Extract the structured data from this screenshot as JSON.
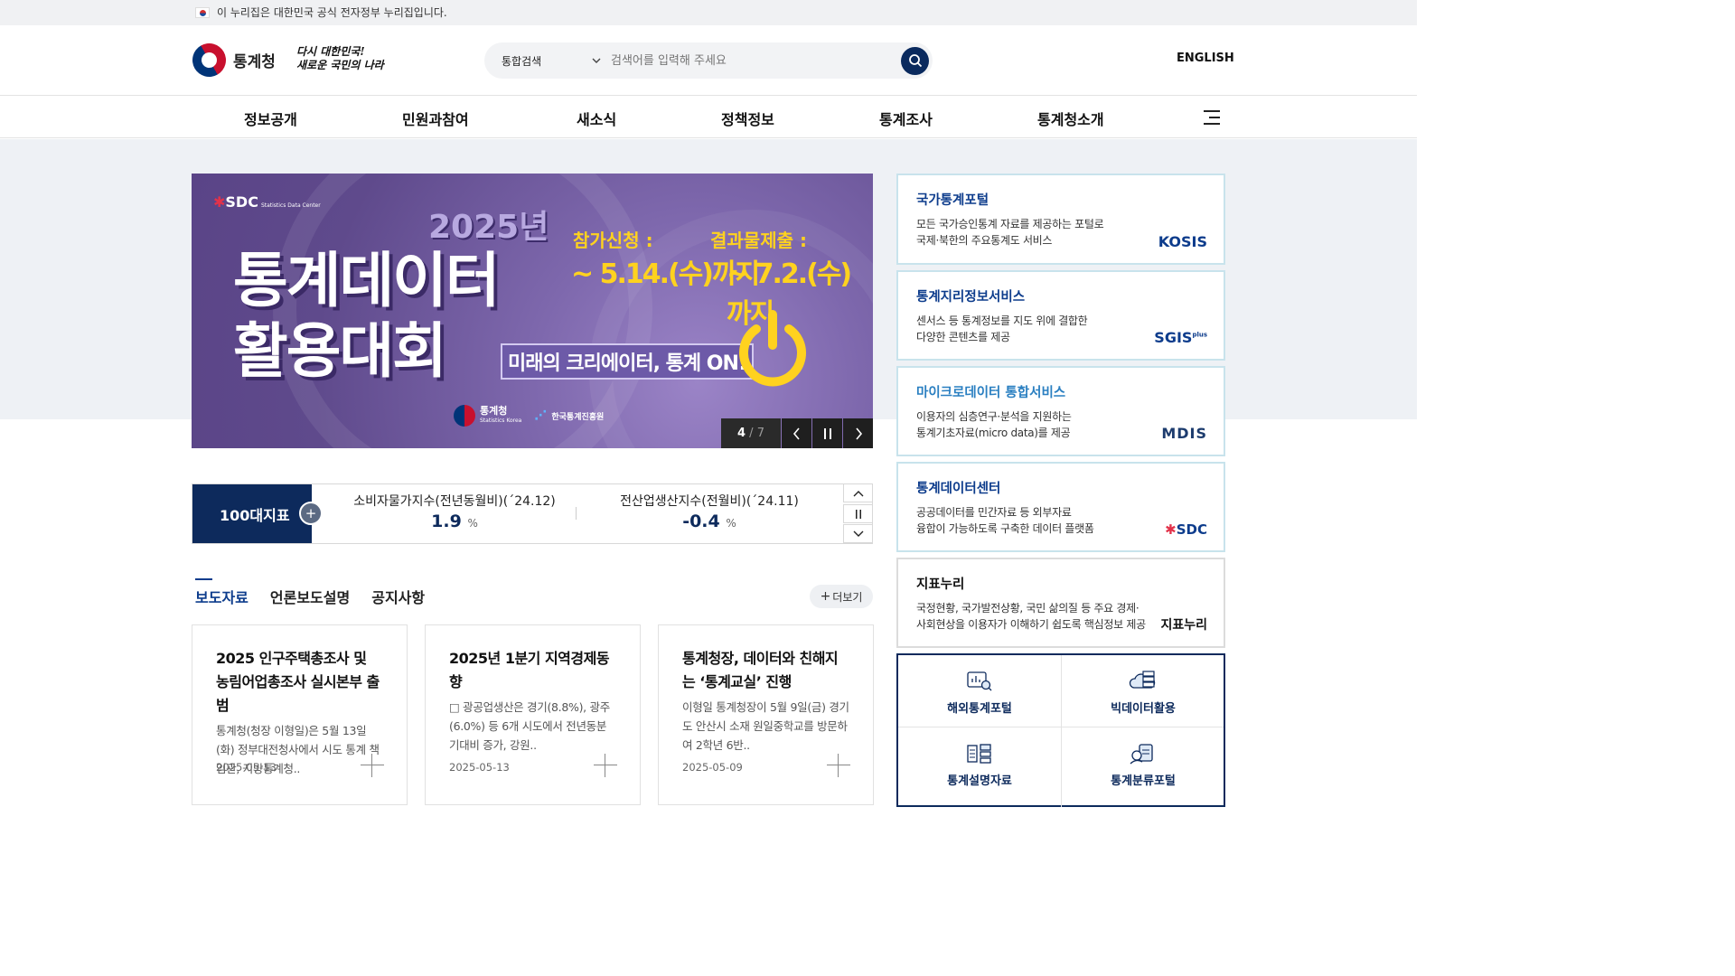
{
  "gov_bar": {
    "text": "이 누리집은 대한민국 공식 전자정부 누리집입니다."
  },
  "header": {
    "logo_text": "통계청",
    "slogan_line1": "다시 대한민국!",
    "slogan_line2": "새로운 국민의 나라",
    "search": {
      "scope": "통합검색",
      "placeholder": "검색어를 입력해 주세요"
    },
    "english": "ENGLISH"
  },
  "nav": {
    "items": [
      "정보공개",
      "민원과참여",
      "새소식",
      "정책정보",
      "통계조사",
      "통계청소개"
    ]
  },
  "banner": {
    "sdc_label": "SDC",
    "sdc_small": "Statistics Data Center",
    "year": "2025년",
    "title_line1": "통계데이터",
    "title_line2": "활용대회",
    "apply_label": "참가신청 :",
    "apply_date": "~ 5.14.(수)까지",
    "submit_label": "결과물제출 :",
    "submit_date": "~ 7.2.(수)까지",
    "slogan": "미래의 크리에이터, 통계 ON!",
    "footer_logo1": "통계청",
    "footer_logo1_en": "Statistics Korea",
    "footer_logo2": "한국통계진흥원",
    "page_current": "4",
    "page_total": "7"
  },
  "indicators": {
    "label": "100대지표",
    "items": [
      {
        "title": "소비자물가지수(전년동월비)(´24.12)",
        "value": "1.9",
        "unit": "%"
      },
      {
        "title": "전산업생산지수(전월비)(´24.11)",
        "value": "-0.4",
        "unit": "%"
      }
    ]
  },
  "news": {
    "tabs": [
      "보도자료",
      "언론보도설명",
      "공지사항"
    ],
    "more_label": "더보기",
    "cards": [
      {
        "title": "2025 인구주택총조사 및 농림어업총조사 실시본부 출범",
        "desc": "통계청(청장 이형일)은 5월 13일(화) 정부대전청사에서 시도 통계 책임관, 지방통계청..",
        "date": "2025-05-13"
      },
      {
        "title": "2025년 1분기 지역경제동향",
        "desc": "□ 광공업생산은 경기(8.8%), 광주(6.0%) 등 6개 시도에서 전년동분기대비 증가, 강원..",
        "date": "2025-05-13"
      },
      {
        "title": "통계청장, 데이터와 친해지는 ‘통계교실’ 진행",
        "desc": "이형일 통계청장이 5월 9일(금) 경기도 안산시 소재 원일중학교를 방문하여 2학년 6반..",
        "date": "2025-05-09"
      }
    ]
  },
  "services": [
    {
      "title": "국가통계포털",
      "desc1": "모든 국가승인통계 자료를 제공하는 포털로",
      "desc2": "국제·북한의 주요통계도 서비스",
      "brand": "KOSIS",
      "color": "#0d3c8c"
    },
    {
      "title": "통계지리정보서비스",
      "desc1": "센서스 등 통계정보를 지도 위에 결합한",
      "desc2": "다양한 콘텐츠를 제공",
      "brand": "SGIS",
      "brand_sup": "plus",
      "color": "#0d3c8c"
    },
    {
      "title": "마이크로데이터 통합서비스",
      "desc1": "이용자의 심층연구·분석을 지원하는",
      "desc2": "통계기초자료(micro data)를 제공",
      "brand": "MDIS",
      "color": "#2a7fc1"
    },
    {
      "title": "통계데이터센터",
      "desc1": "공공데이터를 민간자료 등 외부자료",
      "desc2": "융합이 가능하도록 구축한 데이터 플랫폼",
      "brand": "SDC",
      "color": "#0d3c8c"
    },
    {
      "title": "지표누리",
      "desc1": "국정현황, 국가발전상황, 국민 삶의질 등 주요 경제·",
      "desc2": "사회현상을 이용자가 이해하기 쉽도록 핵심정보 제공",
      "brand": "지표누리",
      "color": "#111111"
    }
  ],
  "quick_links": [
    "해외통계포털",
    "빅데이터활용",
    "통계설명자료",
    "통계분류포털"
  ]
}
